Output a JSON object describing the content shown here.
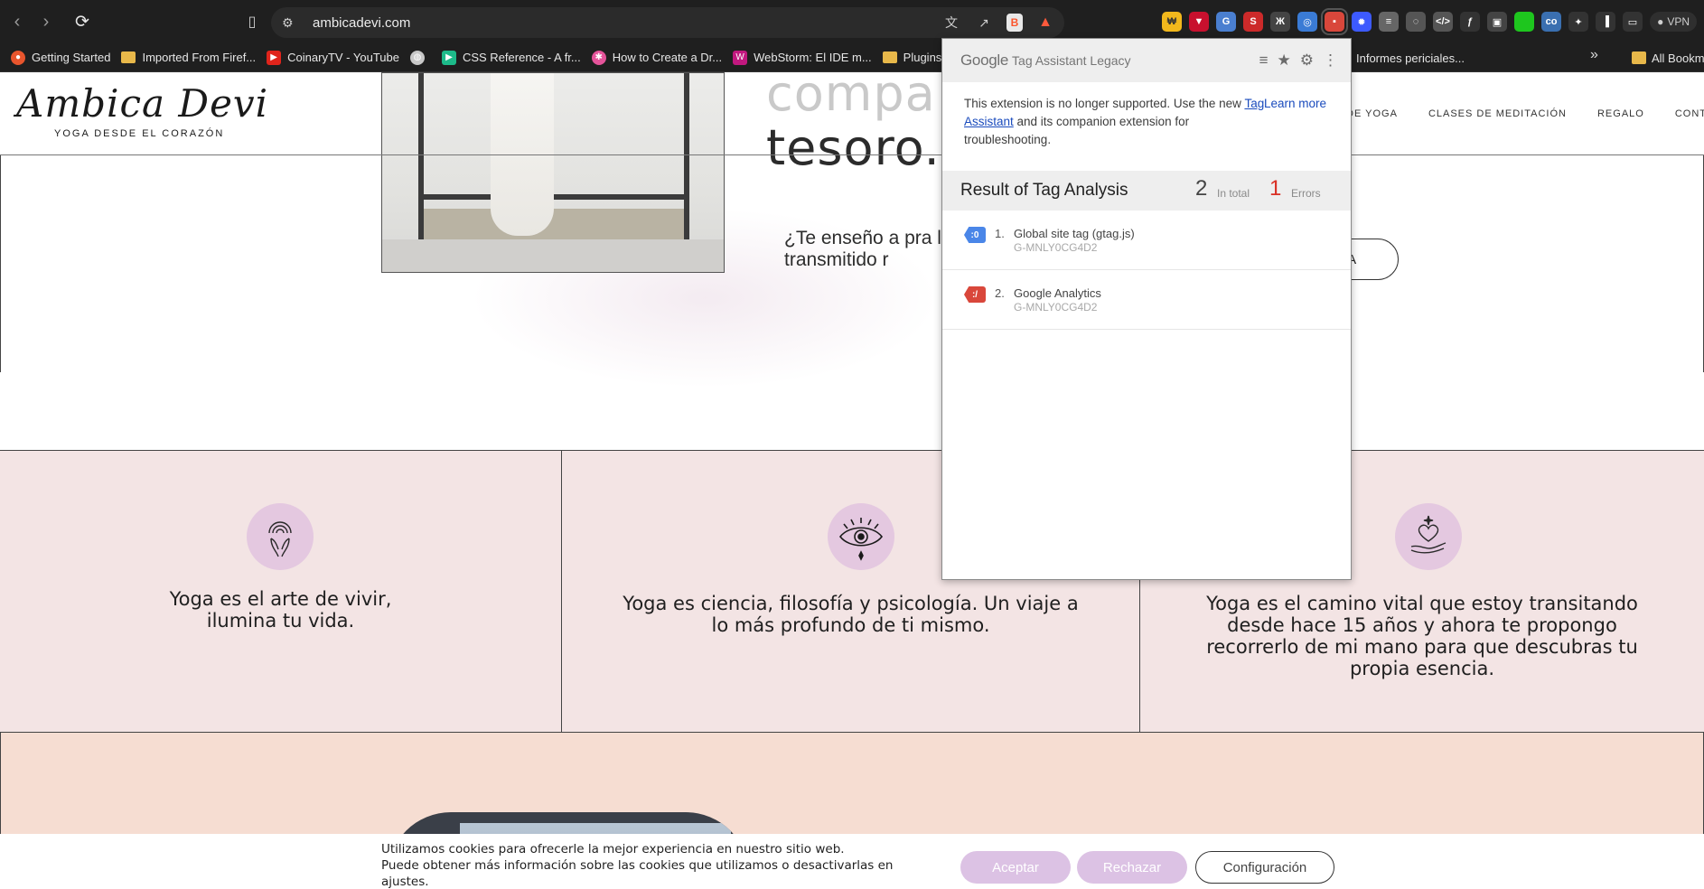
{
  "browser": {
    "url": "ambicadevi.com",
    "vpn_label": "VPN",
    "bookmarks": [
      {
        "label": "Getting Started",
        "icon": "firefox-icon",
        "color": "#e8552d"
      },
      {
        "label": "Imported From Firef...",
        "icon": "folder-icon",
        "color": "#e8b84a"
      },
      {
        "label": "CoinaryTV - YouTube",
        "icon": "youtube-icon",
        "color": "#e0241b"
      },
      {
        "label": "",
        "icon": "globe-icon",
        "color": "#c8c8c8"
      },
      {
        "label": "CSS Reference - A fr...",
        "icon": "css-reference-icon",
        "color": "#1dbb8a"
      },
      {
        "label": "How to Create a Dr...",
        "icon": "star-burst-icon",
        "color": "#e5549a"
      },
      {
        "label": "WebStorm: El IDE m...",
        "icon": "webstorm-icon",
        "color": "#c2187f"
      },
      {
        "label": "Plugins de WordP...",
        "icon": "folder-icon",
        "color": "#e8b84a"
      },
      {
        "label": "Informes periciales...",
        "icon": "folder-icon",
        "color": "#e8b84a"
      }
    ],
    "all_bookmarks_label": "All Bookmarks"
  },
  "site": {
    "logo_script": "Ambica Devi",
    "logo_sub": "YOGA DESDE EL CORAZÓN",
    "nav": [
      "DE YOGA",
      "CLASES DE MEDITACIÓN",
      "REGALO",
      "CONTACTO"
    ],
    "hero_heading_line1": "compa                     te",
    "hero_heading_line2": "tesoro.",
    "hero_text": "¿Te enseño a pra                                          la tradición más                                          han transmitido r",
    "hero_cta": "OGA",
    "features": [
      {
        "text": "Yoga es el arte de vivir, ilumina tu vida.",
        "icon": "praying-hands-icon"
      },
      {
        "text": "Yoga es ciencia, filosofía y psicología. Un viaje a lo más profundo de ti mismo.",
        "icon": "third-eye-icon"
      },
      {
        "text": "Yoga es el camino vital que estoy transitando desde hace 15 años y ahora te propongo recorrerlo de mi mano para que descubras tu propia esencia.",
        "icon": "heart-hand-icon"
      }
    ],
    "cookie": {
      "line1": "Utilizamos cookies para ofrecerle la mejor experiencia en nuestro sitio web.",
      "line2": "Puede obtener más información sobre las cookies que utilizamos o desactivarlas en ajustes.",
      "accept": "Aceptar",
      "reject": "Rechazar",
      "config": "Configuración"
    }
  },
  "tag_assistant": {
    "brand": "Google",
    "title": "Tag Assistant Legacy",
    "notice_pre": "This extension is no longer supported. Use the new ",
    "notice_link": "Tag Assistant",
    "notice_post": " and its companion extension for troubleshooting.",
    "learn_more": "Learn more",
    "result_title": "Result of Tag Analysis",
    "total_count": "2",
    "total_label": "In total",
    "error_count": "1",
    "error_label": "Errors",
    "tags": [
      {
        "num": "1.",
        "name": "Global site tag (gtag.js)",
        "id": "G-MNLY0CG4D2",
        "icon_label": ":0",
        "status": "blue"
      },
      {
        "num": "2.",
        "name": "Google Analytics",
        "id": "G-MNLY0CG4D2",
        "icon_label": ":/",
        "status": "red"
      }
    ]
  },
  "colors": {
    "chrome_bg": "#1f1f1f",
    "feature_bg": "#f3e4e4",
    "badge_bg": "#e4c8e0",
    "peach_bg": "#f6ddd2",
    "cookie_btn": "#dcc2e4",
    "error_red": "#d93025",
    "link_blue": "#1a4bbd"
  }
}
